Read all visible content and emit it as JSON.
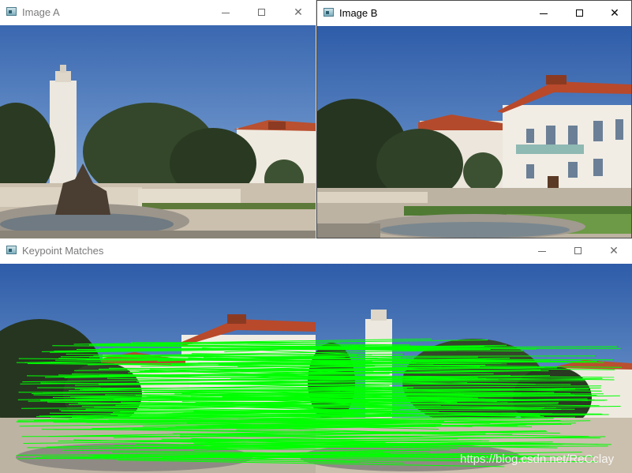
{
  "windows": {
    "image_a": {
      "title": "Image A"
    },
    "image_b": {
      "title": "Image B"
    },
    "matches": {
      "title": "Keypoint Matches"
    }
  },
  "controls": {
    "close_glyph": "✕"
  },
  "watermark": "https://blog.csdn.net/ReCclay",
  "colors": {
    "sky": "#3d6fb6",
    "match_line": "#00ff00",
    "building": "#e8e3d8",
    "roof": "#b84a2c",
    "tree": "#2c3a22"
  }
}
